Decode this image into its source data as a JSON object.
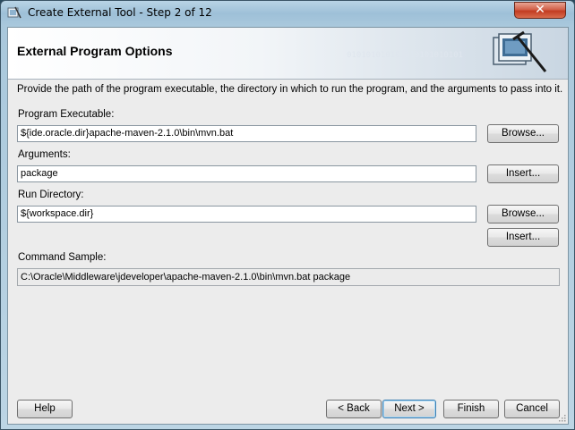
{
  "window": {
    "title": "Create External Tool - Step 2 of 12",
    "close_label": "✕"
  },
  "header": {
    "title": "External Program Options",
    "decor_binary": "010101010101010101010101"
  },
  "description": "Provide the path of the program executable, the directory in which to run the program, and the arguments to pass into it.",
  "fields": {
    "executable": {
      "label": "Program Executable:",
      "value": "${ide.oracle.dir}apache-maven-2.1.0\\bin\\mvn.bat",
      "button": "Browse..."
    },
    "arguments": {
      "label": "Arguments:",
      "value": "package",
      "button": "Insert..."
    },
    "run_dir": {
      "label": "Run Directory:",
      "value": "${workspace.dir}",
      "button": "Browse...",
      "button2": "Insert..."
    },
    "command_sample": {
      "label": "Command Sample:",
      "value": "C:\\Oracle\\Middleware\\jdeveloper\\apache-maven-2.1.0\\bin\\mvn.bat package"
    }
  },
  "footer": {
    "help": "Help",
    "back": "< Back",
    "next": "Next >",
    "finish": "Finish",
    "cancel": "Cancel"
  },
  "colors": {
    "title_bg": "#a9c8dc",
    "client_bg": "#ececec",
    "close_red": "#c23c22"
  },
  "icons": {
    "title": "tool-wizard-icon",
    "header": "external-tool-graphic",
    "close": "close-icon"
  }
}
